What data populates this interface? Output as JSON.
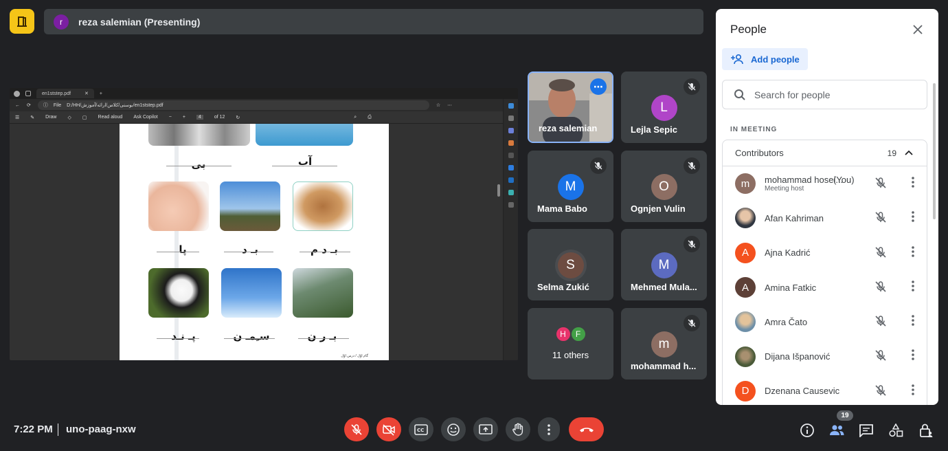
{
  "top": {
    "presenter_initial": "r",
    "presenter_label": "reza salemian (Presenting)"
  },
  "shared": {
    "tab_title": "en1ststep.pdf",
    "file_label": "File",
    "url": "D:/HH/بوسنی/کلاس/ارائه/آموزش/en1ststep.pdf",
    "toolbar": {
      "draw": "Draw",
      "read_aloud": "Read aloud",
      "ask_copilot": "Ask Copilot",
      "page": "4",
      "of": "of 12"
    },
    "words": {
      "bi": "بی",
      "ab": "آب",
      "pa": "پا",
      "bad": "بـ د",
      "badam": "بـ د م",
      "pand": "پـ نـد",
      "saman": "سـِمـ ن",
      "baran": "بـ ر ن"
    },
    "footer": "گام اوّل / درس اوّل"
  },
  "tiles": [
    {
      "name": "reza salemian",
      "type": "video"
    },
    {
      "name": "Lejla Sepic",
      "initial": "L",
      "color": "#b045c8",
      "muted": true
    },
    {
      "name": "Mama Babo",
      "initial": "M",
      "color": "#1a73e8",
      "muted": true
    },
    {
      "name": "Ognjen Vulin",
      "initial": "O",
      "color": "#8d6e63",
      "muted": true
    },
    {
      "name": "Selma Zukić",
      "initial": "S",
      "color": "#6d4c41",
      "muted": false
    },
    {
      "name": "Mehmed Mula...",
      "initial": "M",
      "color": "#5c6bc0",
      "muted": true
    },
    {
      "name": "11 others",
      "avatars": [
        "H",
        "F"
      ],
      "avatar_colors": [
        "#e8336b",
        "#43a047"
      ]
    },
    {
      "name": "mohammad h...",
      "initial": "m",
      "color": "#8d6e63",
      "muted": true
    }
  ],
  "panel": {
    "title": "People",
    "add_people": "Add people",
    "search_placeholder": "Search for people",
    "section": "IN MEETING",
    "contributors_label": "Contributors",
    "contributors_count": "19",
    "people": [
      {
        "name": "mohammad hosei...",
        "suffix": "(You)",
        "sub": "Meeting host",
        "initial": "m",
        "color": "#8d6e63"
      },
      {
        "name": "Afan Kahriman",
        "initial": "",
        "color": "#6b7a88"
      },
      {
        "name": "Ajna Kadrić",
        "initial": "A",
        "color": "#f4511e"
      },
      {
        "name": "Amina Fatkic",
        "initial": "A",
        "color": "#5d4037"
      },
      {
        "name": "Amra Čato",
        "initial": "",
        "color": "#9e8f6a"
      },
      {
        "name": "Dijana Išpanović",
        "initial": "",
        "color": "#55633f"
      },
      {
        "name": "Dzenana Causevic",
        "initial": "D",
        "color": "#f4511e"
      }
    ]
  },
  "bottom": {
    "time": "7:22 PM",
    "meeting_code": "uno-paag-nxw",
    "people_count": "19"
  },
  "colors": {
    "accent": "#1a73e8",
    "danger": "#ea4335",
    "bg": "#202124",
    "surface": "#3c4043"
  }
}
